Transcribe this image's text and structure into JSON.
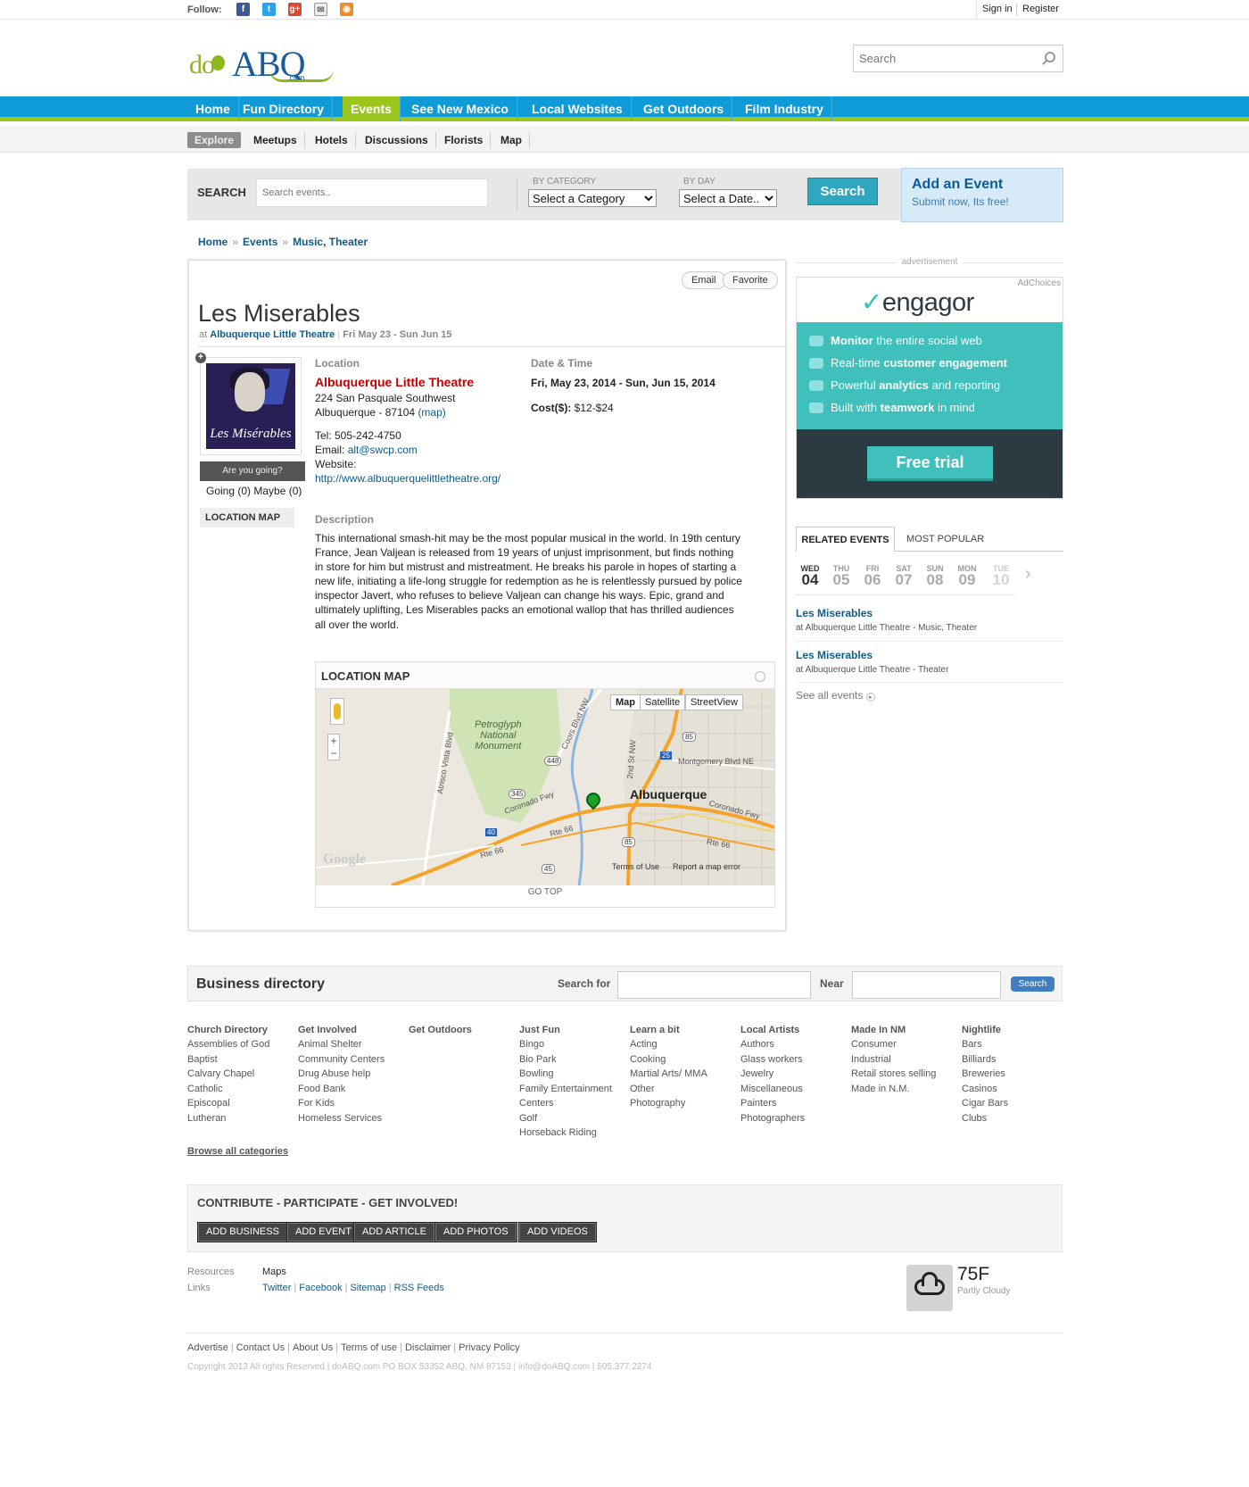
{
  "topbar": {
    "follow_label": "Follow:",
    "social": [
      "facebook-icon",
      "twitter-icon",
      "googleplus-icon",
      "email-icon",
      "rss-icon"
    ],
    "sign_in": "Sign in",
    "register": "Register"
  },
  "header": {
    "logo_do": "do",
    "logo_abq": "ABQ",
    "logo_com": ".com",
    "search_placeholder": "Search"
  },
  "nav": {
    "items": [
      "Home",
      "Fun Directory",
      "Events",
      "See New Mexico",
      "Local Websites",
      "Get Outdoors",
      "Film Industry"
    ],
    "active": "Events",
    "active_color": "#9bc61b",
    "bar_color": "#0f9bd7"
  },
  "subnav": {
    "items": [
      "Explore",
      "Meetups",
      "Hotels",
      "Discussions",
      "Florists",
      "Map"
    ]
  },
  "event_search": {
    "label": "SEARCH",
    "placeholder": "Search events..",
    "by_category_label": "BY CATEGORY",
    "category_value": "Select a Category",
    "by_day_label": "BY DAY",
    "day_value": "Select a Date..",
    "button": "Search"
  },
  "add_event": {
    "title": "Add an Event",
    "subtitle": "Submit now, Its free!"
  },
  "breadcrumb": [
    "Home",
    "Events",
    "Music",
    "Theater"
  ],
  "event": {
    "email_btn": "Email",
    "favorite_btn": "Favorite",
    "title": "Les Miserables",
    "at_label": "at",
    "venue_link": "Albuquerque Little Theatre",
    "date_short": "Fri May 23 - Sun Jun 15",
    "poster_title": "Les Misérables",
    "going_btn": "Are you going?",
    "going_counts": "Going (0) Maybe (0)",
    "location_map_tab": "LOCATION MAP",
    "location_heading": "Location",
    "venue_name": "Albuquerque Little Theatre",
    "address1": "224 San Pasquale Southwest",
    "address2": "Albuquerque - 87104",
    "map_link": "(map)",
    "tel": "Tel: 505-242-4750",
    "email_label": "Email:",
    "email": "alt@swcp.com",
    "website_label": "Website:",
    "website": "http://www.albuquerquelittletheatre.org/",
    "datetime_heading": "Date & Time",
    "datetime": "Fri, May 23, 2014 - Sun, Jun 15, 2014",
    "cost_label": "Cost($):",
    "cost": "$12-$24",
    "description_heading": "Description",
    "description": "This international smash-hit may be the most popular musical in the world. In 19th century France, Jean Valjean is released from 19 years of unjust imprisonment, but finds nothing in store for him but mistrust and mistreatment. He breaks his parole in hopes of starting a new life, initiating a life-long struggle for redemption as he is relentlessly pursued by police inspector Javert, who refuses to believe Valjean can change his ways. Epic, grand and ultimately uplifting, Les Miserables packs an emotional wallop that has thrilled audiences all over the world."
  },
  "map": {
    "heading": "LOCATION MAP",
    "btn_map": "Map",
    "btn_satellite": "Satellite",
    "btn_street": "StreetView",
    "city_label": "Albuquerque",
    "park_label1": "Petroglyph",
    "park_label2": "National",
    "park_label3": "Monument",
    "road_coronado": "Coronado Fwy",
    "road_rte66": "Rte 66",
    "road_coors": "Coors Blvd NW",
    "road_atrisco": "Atrisco Vista Blvd",
    "road_2nd": "2nd St NW",
    "road_montgomery": "Montgomery Blvd NE",
    "shield_448": "448",
    "shield_345": "345",
    "shield_85a": "85",
    "shield_85b": "85",
    "shield_25": "25",
    "shield_40": "40",
    "shield_45": "45",
    "google": "Google",
    "terms": "Terms of Use",
    "report": "Report a map error",
    "go_top": "GO TOP"
  },
  "sidebar": {
    "ad_label": "advertisement",
    "ad_choices": "AdChoices",
    "ad_logo": "engagor",
    "ad_lines": [
      {
        "pre": "",
        "bold": "Monitor",
        "post": " the entire social web"
      },
      {
        "pre": "Real-time ",
        "bold": "customer engagement",
        "post": ""
      },
      {
        "pre": "Powerful ",
        "bold": "analytics",
        "post": " and reporting"
      },
      {
        "pre": "Built with ",
        "bold": "teamwork",
        "post": " in mind"
      }
    ],
    "ad_button": "Free trial",
    "tab_related": "RELATED EVENTS",
    "tab_popular": "MOST POPULAR",
    "days": [
      {
        "dn": "WED",
        "dd": "04"
      },
      {
        "dn": "THU",
        "dd": "05"
      },
      {
        "dn": "FRI",
        "dd": "06"
      },
      {
        "dn": "SAT",
        "dd": "07"
      },
      {
        "dn": "SUN",
        "dd": "08"
      },
      {
        "dn": "MON",
        "dd": "09"
      },
      {
        "dn": "TUE",
        "dd": "10"
      }
    ],
    "related": [
      {
        "name": "Les Miserables",
        "venue": "at Albuquerque Little Theatre - Music, Theater"
      },
      {
        "name": "Les Miserables",
        "venue": "at Albuquerque Little Theatre - Theater"
      }
    ],
    "see_all": "See all events"
  },
  "business": {
    "title": "Business directory",
    "search_for": "Search for",
    "near": "Near",
    "button": "Search",
    "columns": [
      {
        "h": "Church Directory",
        "items": [
          "Assemblies of God",
          "Baptist",
          "Calvary Chapel",
          "Catholic",
          "Episcopal",
          "Lutheran"
        ]
      },
      {
        "h": "Get Involved",
        "items": [
          "Animal Shelter",
          "Community Centers",
          "Drug Abuse help",
          "Food Bank",
          "For Kids",
          "Homeless Services"
        ]
      },
      {
        "h": "Get Outdoors",
        "items": []
      },
      {
        "h": "Just Fun",
        "items": [
          "Bingo",
          "Bio Park",
          "Bowling",
          "Family Entertainment",
          "Centers",
          "Golf",
          "Horseback Riding"
        ]
      },
      {
        "h": "Learn a bit",
        "items": [
          "Acting",
          "Cooking",
          "Martial Arts/ MMA",
          "Other",
          "Photography"
        ]
      },
      {
        "h": "Local Artists",
        "items": [
          "Authors",
          "Glass workers",
          "Jewelry",
          "Miscellaneous",
          "Painters",
          "Photographers"
        ]
      },
      {
        "h": "Made In NM",
        "items": [
          "Consumer",
          "Industrial",
          "Retail stores selling",
          "Made in N.M."
        ]
      },
      {
        "h": "Nightlife",
        "items": [
          "Bars",
          "Billiards",
          "Breweries",
          "Casinos",
          "Cigar Bars",
          "Clubs"
        ]
      }
    ],
    "browse_all": "Browse all categories"
  },
  "contribute": {
    "title": "CONTRIBUTE - PARTICIPATE - GET INVOLVED!",
    "buttons": [
      "ADD BUSINESS",
      "ADD EVENT",
      "ADD ARTICLE",
      "ADD PHOTOS",
      "ADD VIDEOS"
    ]
  },
  "footer": {
    "resources_label": "Resources",
    "resources": [
      "Maps"
    ],
    "links_label": "Links",
    "links": [
      "Twitter",
      "Facebook",
      "Sitemap",
      "RSS Feeds"
    ],
    "temp": "75F",
    "condition": "Partly Cloudy",
    "bottom_links": [
      "Advertise",
      "Contact Us",
      "About Us",
      "Terms of use",
      "Disclaimer",
      "Privacy Policy"
    ],
    "copyright": "Copyright 2013 All rights Reserved | doABQ.com PO BOX 53352 ABQ, NM 87153 | info@doABQ.com | 505.377.2274"
  }
}
